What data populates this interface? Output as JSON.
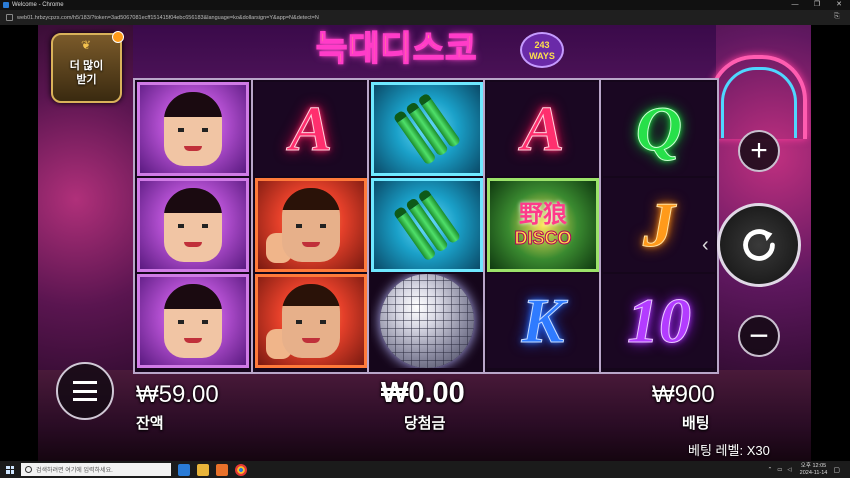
{
  "window": {
    "title": "Welcome - Chrome",
    "minimize": "—",
    "maximize": "❐",
    "close": "✕"
  },
  "address": {
    "url": "web01.hrbzycpzs.com/h5/183/?token=3ad5067081ecff151415f04ebc656183&language=ko&dollarsign=Y&app=N&detect=N"
  },
  "game": {
    "bonus_label_line1": "더 많이",
    "bonus_label_line2": "받기",
    "logo_text": "늑대디스코",
    "ways_number": "243",
    "ways_label": "WAYS",
    "reels": [
      [
        "lady-symbol",
        "lady-symbol",
        "lady-symbol"
      ],
      [
        "A",
        "man-symbol",
        "man-symbol"
      ],
      [
        "bottles-symbol",
        "bottles-symbol",
        "disco-ball-symbol"
      ],
      [
        "A",
        "disco-wild-symbol",
        "K"
      ],
      [
        "Q",
        "J",
        "10"
      ]
    ],
    "symbol_text": {
      "A": "A",
      "Q": "Q",
      "J": "J",
      "K": "K",
      "ten": "10",
      "disco_top": "野狼",
      "disco_bottom": "DISCO"
    },
    "colors": {
      "A": "#ff2f6e",
      "Q": "#27e04a",
      "J": "#ff9a1a",
      "K": "#2f7bff",
      "ten": "#b33cff"
    },
    "balance_amount": "₩59.00",
    "balance_label": "잔액",
    "win_amount": "₩0.00",
    "win_label": "당첨금",
    "bet_amount": "₩900",
    "bet_label": "배팅",
    "bet_level_label": "베팅 레벨:",
    "bet_level_value": "X30",
    "plus_symbol": "+",
    "minus_symbol": "−",
    "spin_arrow": "‹"
  },
  "taskbar": {
    "search_placeholder": "검색하려면 여기에 입력하세요.",
    "time": "오후 12:05",
    "date": "2024-11-14"
  }
}
